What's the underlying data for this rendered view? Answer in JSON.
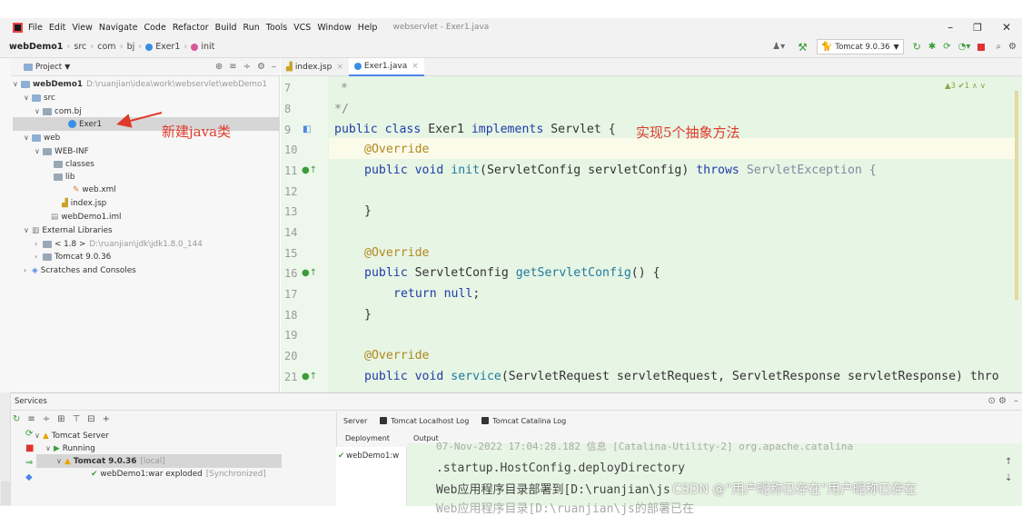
{
  "menubar": {
    "items": [
      "File",
      "Edit",
      "View",
      "Navigate",
      "Code",
      "Refactor",
      "Build",
      "Run",
      "Tools",
      "VCS",
      "Window",
      "Help"
    ],
    "title": "webservlet - Exer1.java"
  },
  "navbar": {
    "crumbs": [
      "webDemo1",
      "src",
      "com",
      "bj",
      "Exer1",
      "init"
    ],
    "run_config": "Tomcat 9.0.36"
  },
  "project": {
    "header": "Project",
    "tree": [
      {
        "label": "webDemo1",
        "hint": "D:\\ruanjian\\idea\\work\\webservlet\\webDemo1"
      },
      {
        "label": "src"
      },
      {
        "label": "com.bj"
      },
      {
        "label": "Exer1"
      },
      {
        "label": "web"
      },
      {
        "label": "WEB-INF"
      },
      {
        "label": "classes"
      },
      {
        "label": "lib"
      },
      {
        "label": "web.xml"
      },
      {
        "label": "index.jsp"
      },
      {
        "label": "webDemo1.iml"
      },
      {
        "label": "External Libraries"
      },
      {
        "label": "< 1.8 >",
        "hint": "D:\\ruanjian\\jdk\\jdk1.8.0_144"
      },
      {
        "label": "Tomcat 9.0.36"
      },
      {
        "label": "Scratches and Consoles"
      }
    ]
  },
  "editor": {
    "tabs": [
      "index.jsp",
      "Exer1.java"
    ],
    "inspection": "▲3 ✔1 ∧ ∨",
    "line_numbers": [
      "7",
      "8",
      "9",
      "10",
      "11",
      "12",
      "13",
      "14",
      "15",
      "16",
      "17",
      "18",
      "19",
      "20",
      "21"
    ],
    "lines": {
      "l7": "*",
      "l8": "*/",
      "l9a": "public class ",
      "l9b": "Exer1",
      "l9c": " implements ",
      "l9d": "Servlet {",
      "l10": "@Override",
      "l11a": "public void ",
      "l11b": "init",
      "l11c": "(ServletConfig servletConfig) ",
      "l11d": "throws ",
      "l11e": "ServletException {",
      "l13": "}",
      "l15": "@Override",
      "l16a": "public ",
      "l16b": "ServletConfig ",
      "l16c": "getServletConfig",
      "l16d": "() {",
      "l17a": "return ",
      "l17b": "null",
      "l17c": ";",
      "l18": "}",
      "l20": "@Override",
      "l21a": "public void ",
      "l21b": "service",
      "l21c": "(ServletRequest servletRequest, ServletResponse servletResponse) thro"
    }
  },
  "annotations": {
    "new_class": "新建java类",
    "implement": "实现5个抽象方法"
  },
  "services": {
    "header": "Services",
    "tree": [
      "Tomcat Server",
      "Running",
      "Tomcat 9.0.36",
      "[local]",
      "webDemo1:war exploded",
      "[Synchronized]"
    ],
    "tabs": [
      "Server",
      "Tomcat Localhost Log",
      "Tomcat Catalina Log"
    ],
    "deployment_header": "Deployment",
    "output_header": "Output",
    "deployment_item": "webDemo1:w",
    "output_lines": [
      "07-Nov-2022 17:04:28.182 信息 [Catalina-Utility-2] org.apache.catalina",
      ".startup.HostConfig.deployDirectory",
      "Web应用程序目录部署到[D:\\ruanjian\\js",
      "Web应用程序目录[D:\\ruanjian\\js的部署已在"
    ],
    "watermark": "CSDN @“用户昵称已存在”用户昵称已存在"
  },
  "colors": {
    "accent": "#4a86e8",
    "annotation_red": "#e03a2a",
    "editor_bg": "#e7f5e4"
  }
}
